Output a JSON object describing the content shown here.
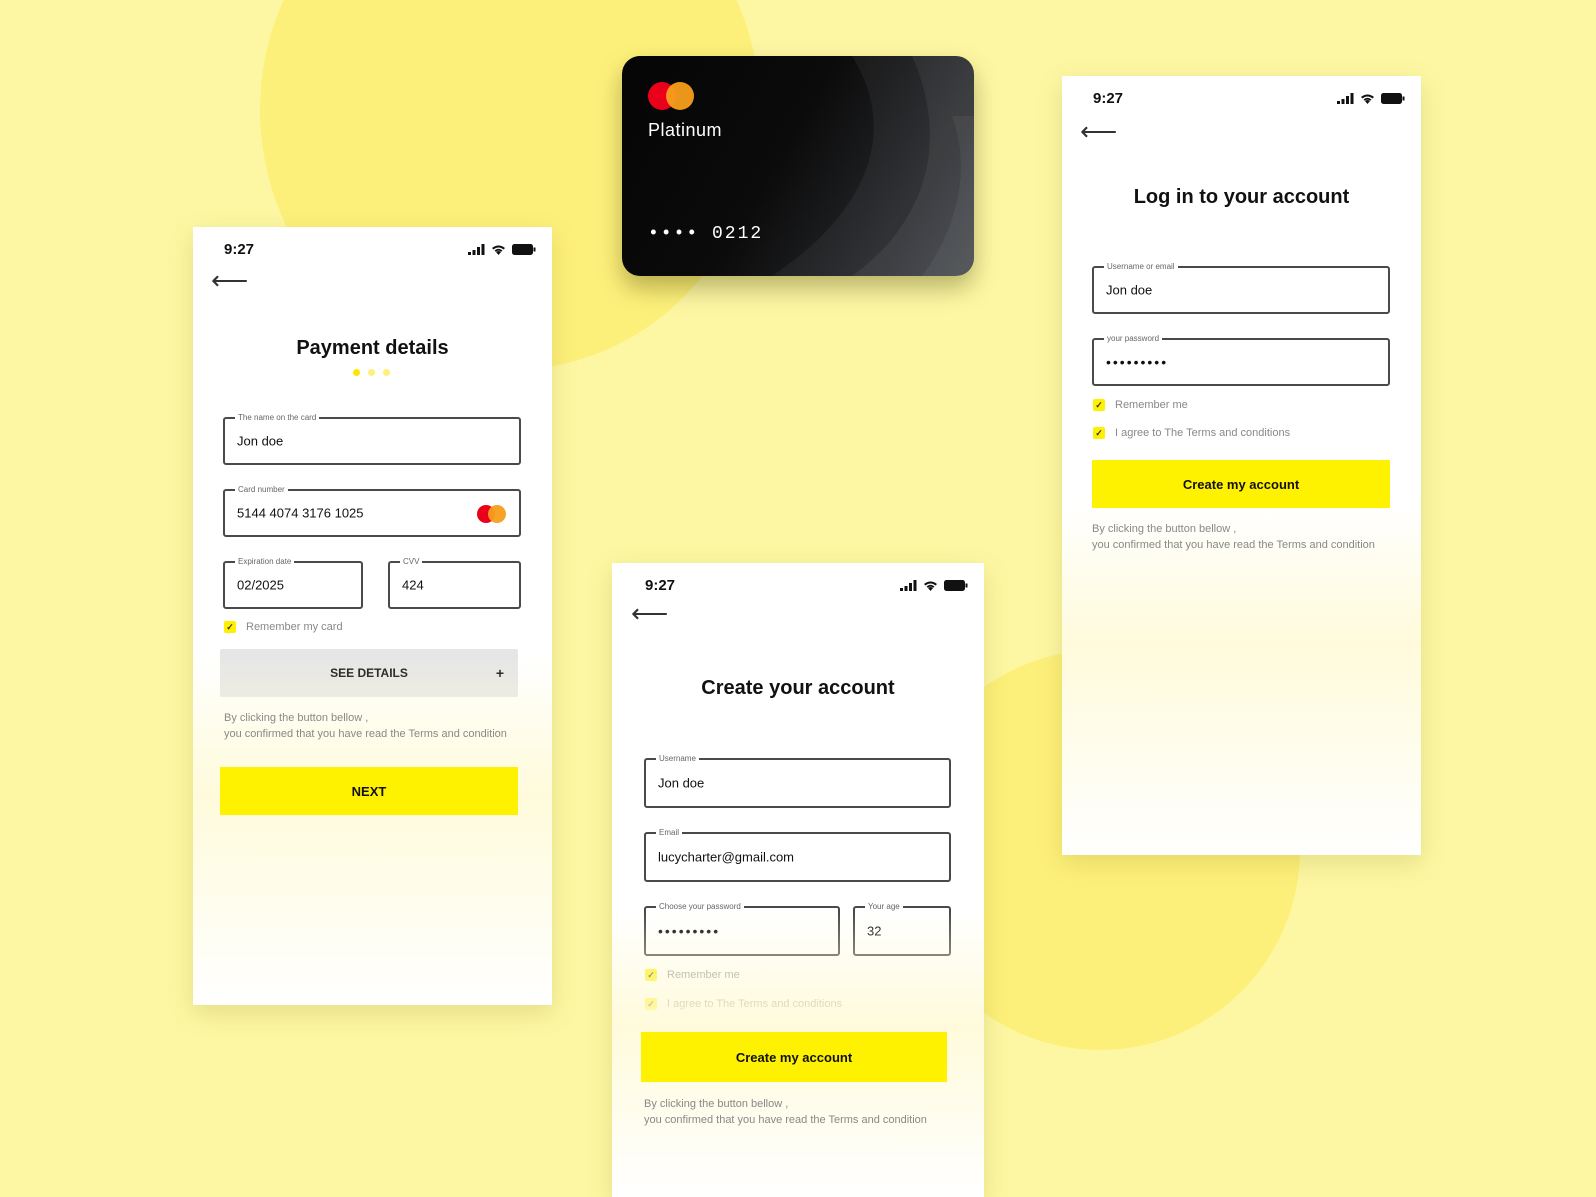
{
  "colors": {
    "accent": "#fff200",
    "background": "#fdf7a3",
    "card": "#0c0c0c"
  },
  "card": {
    "brand_icon": "mastercard-logo",
    "tier": "Platinum",
    "masked": "•••• 0212"
  },
  "payment": {
    "time": "9:27",
    "title": "Payment details",
    "name_label": "The name on the card",
    "name_value": "Jon doe",
    "card_label": "Card number",
    "card_value": "5144  4074  3176  1025",
    "exp_label": "Expiration date",
    "exp_value": "02/2025",
    "cvv_label": "CVV",
    "cvv_value": "424",
    "remember": "Remember my card",
    "see_details": "SEE DETAILS",
    "plus": "+",
    "disclaimer_1": "By clicking the button bellow ,",
    "disclaimer_2": " you confirmed that you have read the Terms and condition",
    "next": "NEXT"
  },
  "create": {
    "time": "9:27",
    "title": "Create your account",
    "username_label": "Username",
    "username_value": "Jon doe",
    "email_label": "Email",
    "email_value": "lucycharter@gmail.com",
    "password_label": "Choose your password",
    "password_value": "•••••••••",
    "age_label": "Your age",
    "age_value": "32",
    "remember": "Remember me",
    "agree": "I agree to The Terms and conditions",
    "button": "Create my account",
    "disclaimer_1": "By clicking the button bellow ,",
    "disclaimer_2": " you confirmed that you have read the Terms and condition"
  },
  "login": {
    "time": "9:27",
    "title": "Log in to your account",
    "username_label": "Username or email",
    "username_value": "Jon doe",
    "password_label": "your password",
    "password_value": "•••••••••",
    "remember": "Remember me",
    "agree": "I agree to The Terms and conditions",
    "button": "Create my account",
    "disclaimer_1": "By clicking the button bellow ,",
    "disclaimer_2": " you confirmed that you have read the Terms and condition"
  }
}
